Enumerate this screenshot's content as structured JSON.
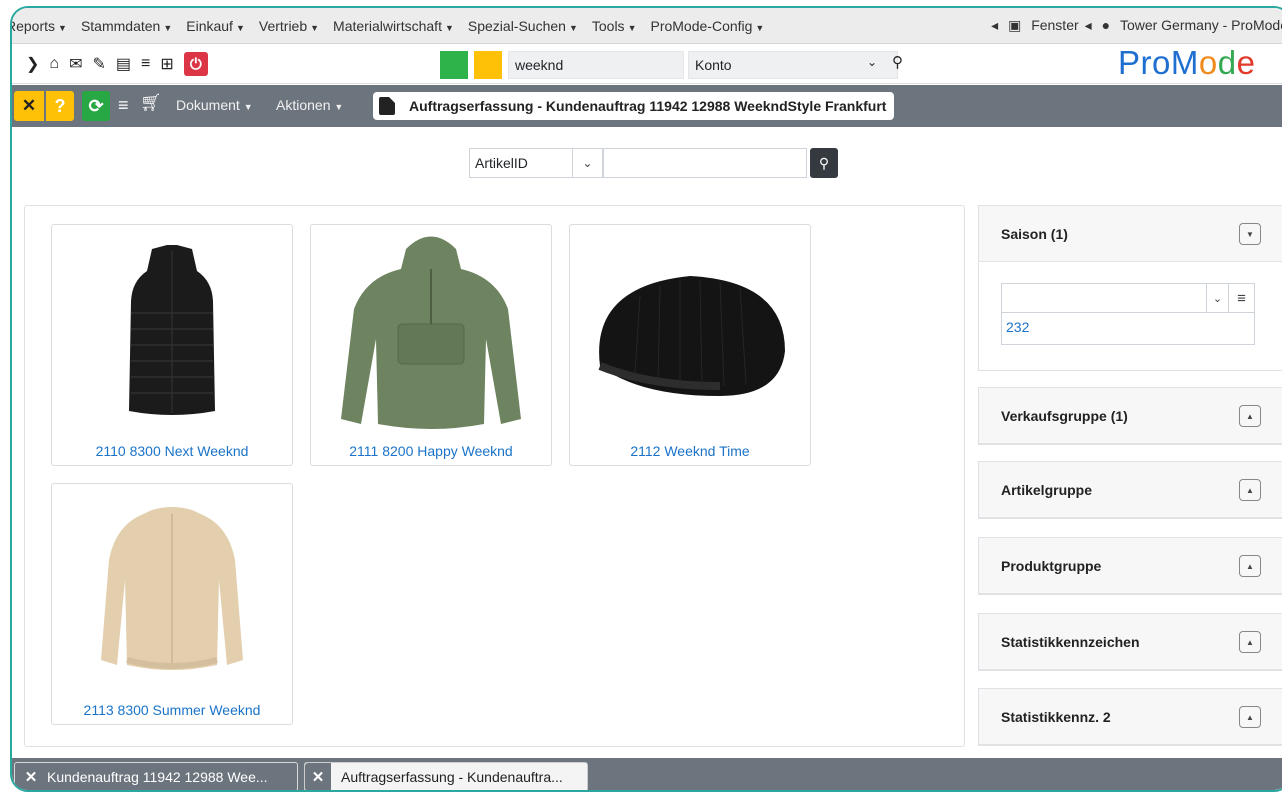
{
  "menu": {
    "items": [
      "Reports",
      "Stammdaten",
      "Einkauf",
      "Vertrieb",
      "Materialwirtschaft",
      "Spezial-Suchen",
      "Tools",
      "ProMode-Config"
    ],
    "fenster": "Fenster",
    "user": "Tower Germany - ProMode"
  },
  "toolbar": {
    "search_value": "weeknd",
    "konto_value": "Konto",
    "logo": {
      "pro": "Pro",
      "m": "M",
      "o": "o",
      "d": "d",
      "e": "e"
    }
  },
  "actionbar": {
    "help_label": "?",
    "dokument_label": "Dokument",
    "aktionen_label": "Aktionen",
    "title": "Auftragserfassung - Kundenauftrag 11942 12988 WeekndStyle Frankfurt"
  },
  "search": {
    "field_label": "ArtikelID",
    "value": ""
  },
  "products": [
    {
      "label": "2110 8300 Next Weeknd",
      "image": "black-puffer-vest"
    },
    {
      "label": "2111 8200 Happy Weeknd",
      "image": "olive-anorak"
    },
    {
      "label": "2112 Weeknd Time",
      "image": "black-beanie"
    },
    {
      "label": "2113 8300 Summer Weeknd",
      "image": "beige-bomber-jacket"
    }
  ],
  "filters": {
    "saison": {
      "title": "Saison (1)",
      "value": "232"
    },
    "verkaufsgruppe": {
      "title": "Verkaufsgruppe (1)"
    },
    "artikelgruppe": {
      "title": "Artikelgruppe"
    },
    "produktgruppe": {
      "title": "Produktgruppe"
    },
    "statistikkennzeichen": {
      "title": "Statistikkennzeichen"
    },
    "statistikkennz2": {
      "title": "Statistikkennz. 2"
    }
  },
  "tasks": [
    {
      "label": "Kundenauftrag 11942 12988 Wee..."
    },
    {
      "label": "Auftragserfassung - Kundenauftra..."
    }
  ],
  "colors": {
    "accent_teal": "#2aa8a0",
    "status_green": "#2db34a",
    "status_yellow": "#ffc107",
    "bar_gray": "#6c757d",
    "link_blue": "#1a73c9"
  }
}
